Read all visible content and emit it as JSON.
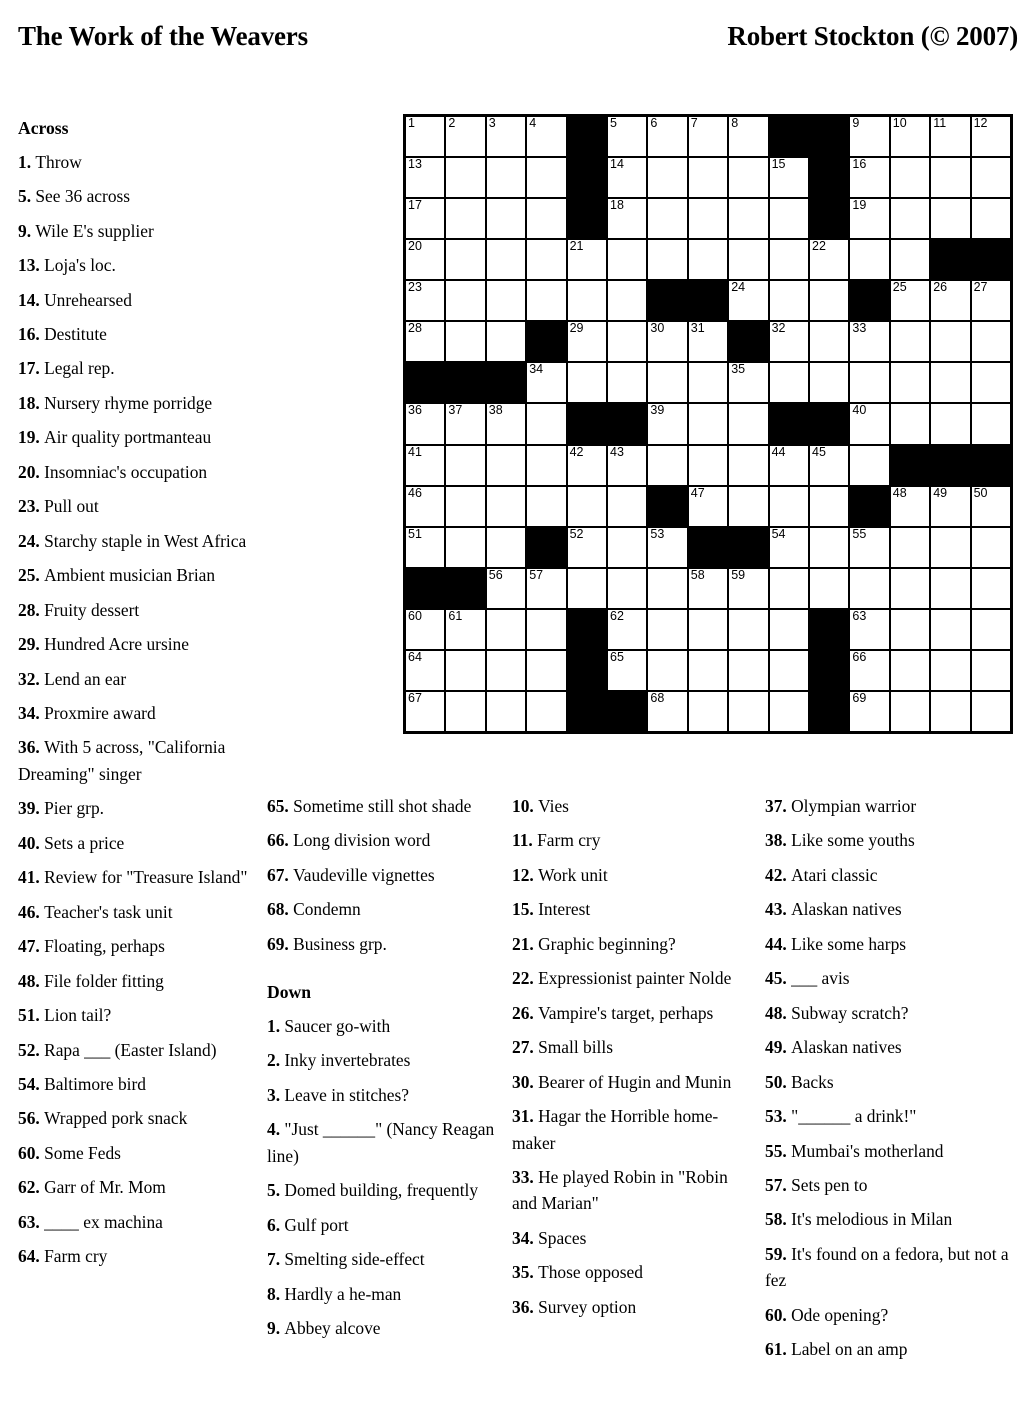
{
  "header": {
    "title": "The Work of the Weavers",
    "author": "Robert Stockton (© 2007)"
  },
  "labels": {
    "across": "Across",
    "down": "Down"
  },
  "grid": {
    "rows": 15,
    "cols": 15,
    "colors": {
      "cell": "#ffffff",
      "block": "#000000",
      "border": "#000000"
    },
    "blocks": [
      [
        0,
        4
      ],
      [
        0,
        9
      ],
      [
        0,
        10
      ],
      [
        1,
        4
      ],
      [
        1,
        10
      ],
      [
        2,
        4
      ],
      [
        2,
        10
      ],
      [
        3,
        13
      ],
      [
        3,
        14
      ],
      [
        4,
        6
      ],
      [
        4,
        7
      ],
      [
        4,
        11
      ],
      [
        5,
        3
      ],
      [
        5,
        8
      ],
      [
        6,
        0
      ],
      [
        6,
        1
      ],
      [
        6,
        2
      ],
      [
        7,
        4
      ],
      [
        7,
        5
      ],
      [
        7,
        9
      ],
      [
        7,
        10
      ],
      [
        8,
        12
      ],
      [
        8,
        13
      ],
      [
        8,
        14
      ],
      [
        9,
        6
      ],
      [
        9,
        11
      ],
      [
        10,
        3
      ],
      [
        10,
        7
      ],
      [
        10,
        8
      ],
      [
        11,
        0
      ],
      [
        11,
        1
      ],
      [
        12,
        4
      ],
      [
        12,
        10
      ],
      [
        13,
        4
      ],
      [
        13,
        10
      ],
      [
        14,
        4
      ],
      [
        14,
        5
      ],
      [
        14,
        10
      ]
    ],
    "numbers": [
      [
        0,
        0,
        "1"
      ],
      [
        0,
        1,
        "2"
      ],
      [
        0,
        2,
        "3"
      ],
      [
        0,
        3,
        "4"
      ],
      [
        0,
        5,
        "5"
      ],
      [
        0,
        6,
        "6"
      ],
      [
        0,
        7,
        "7"
      ],
      [
        0,
        8,
        "8"
      ],
      [
        0,
        11,
        "9"
      ],
      [
        0,
        12,
        "10"
      ],
      [
        0,
        13,
        "11"
      ],
      [
        0,
        14,
        "12"
      ],
      [
        1,
        0,
        "13"
      ],
      [
        1,
        5,
        "14"
      ],
      [
        1,
        9,
        "15"
      ],
      [
        1,
        11,
        "16"
      ],
      [
        2,
        0,
        "17"
      ],
      [
        2,
        5,
        "18"
      ],
      [
        2,
        11,
        "19"
      ],
      [
        3,
        0,
        "20"
      ],
      [
        3,
        4,
        "21"
      ],
      [
        3,
        10,
        "22"
      ],
      [
        4,
        0,
        "23"
      ],
      [
        4,
        8,
        "24"
      ],
      [
        4,
        12,
        "25"
      ],
      [
        4,
        13,
        "26"
      ],
      [
        4,
        14,
        "27"
      ],
      [
        5,
        0,
        "28"
      ],
      [
        5,
        4,
        "29"
      ],
      [
        5,
        6,
        "30"
      ],
      [
        5,
        7,
        "31"
      ],
      [
        5,
        9,
        "32"
      ],
      [
        5,
        11,
        "33"
      ],
      [
        6,
        3,
        "34"
      ],
      [
        6,
        8,
        "35"
      ],
      [
        7,
        0,
        "36"
      ],
      [
        7,
        1,
        "37"
      ],
      [
        7,
        2,
        "38"
      ],
      [
        7,
        6,
        "39"
      ],
      [
        7,
        11,
        "40"
      ],
      [
        8,
        0,
        "41"
      ],
      [
        8,
        4,
        "42"
      ],
      [
        8,
        5,
        "43"
      ],
      [
        8,
        9,
        "44"
      ],
      [
        8,
        10,
        "45"
      ],
      [
        9,
        0,
        "46"
      ],
      [
        9,
        7,
        "47"
      ],
      [
        9,
        12,
        "48"
      ],
      [
        9,
        13,
        "49"
      ],
      [
        9,
        14,
        "50"
      ],
      [
        10,
        0,
        "51"
      ],
      [
        10,
        4,
        "52"
      ],
      [
        10,
        6,
        "53"
      ],
      [
        10,
        9,
        "54"
      ],
      [
        10,
        11,
        "55"
      ],
      [
        11,
        2,
        "56"
      ],
      [
        11,
        3,
        "57"
      ],
      [
        11,
        7,
        "58"
      ],
      [
        11,
        8,
        "59"
      ],
      [
        12,
        0,
        "60"
      ],
      [
        12,
        1,
        "61"
      ],
      [
        12,
        5,
        "62"
      ],
      [
        12,
        11,
        "63"
      ],
      [
        13,
        0,
        "64"
      ],
      [
        13,
        5,
        "65"
      ],
      [
        13,
        11,
        "66"
      ],
      [
        14,
        0,
        "67"
      ],
      [
        14,
        6,
        "68"
      ],
      [
        14,
        11,
        "69"
      ]
    ]
  },
  "across_clues_col1": [
    {
      "num": "1.",
      "text": "Throw"
    },
    {
      "num": "5.",
      "text": "See 36 across"
    },
    {
      "num": "9.",
      "text": "Wile E's supplier"
    },
    {
      "num": "13.",
      "text": "Loja's loc."
    },
    {
      "num": "14.",
      "text": "Unrehearsed"
    },
    {
      "num": "16.",
      "text": "Destitute"
    },
    {
      "num": "17.",
      "text": "Legal rep."
    },
    {
      "num": "18.",
      "text": "Nursery rhyme porridge"
    },
    {
      "num": "19.",
      "text": "Air quality portmanteau"
    },
    {
      "num": "20.",
      "text": "Insomniac's occupation"
    },
    {
      "num": "23.",
      "text": "Pull out"
    },
    {
      "num": "24.",
      "text": "Starchy staple in West Africa"
    },
    {
      "num": "25.",
      "text": "Ambient musician Brian"
    },
    {
      "num": "28.",
      "text": "Fruity dessert"
    },
    {
      "num": "29.",
      "text": "Hundred Acre ursine"
    },
    {
      "num": "32.",
      "text": "Lend an ear"
    },
    {
      "num": "34.",
      "text": "Proxmire award"
    },
    {
      "num": "36.",
      "text": "With 5 across, \"California Dreaming\" singer"
    },
    {
      "num": "39.",
      "text": "Pier grp."
    },
    {
      "num": "40.",
      "text": "Sets a price"
    },
    {
      "num": "41.",
      "text": "Review for \"Treasure Island\""
    },
    {
      "num": "46.",
      "text": "Teacher's task unit"
    },
    {
      "num": "47.",
      "text": "Floating, perhaps"
    },
    {
      "num": "48.",
      "text": "File folder fitting"
    },
    {
      "num": "51.",
      "text": "Lion tail?"
    },
    {
      "num": "52.",
      "text": "Rapa ___ (Easter Island)"
    },
    {
      "num": "54.",
      "text": "Baltimore bird"
    },
    {
      "num": "56.",
      "text": "Wrapped pork snack"
    },
    {
      "num": "60.",
      "text": "Some Feds"
    },
    {
      "num": "62.",
      "text": "Garr of Mr. Mom"
    },
    {
      "num": "63.",
      "text": "____ ex machina"
    },
    {
      "num": "64.",
      "text": "Farm cry"
    }
  ],
  "across_clues_col2": [
    {
      "num": "65.",
      "text": "Sometime still shot shade"
    },
    {
      "num": "66.",
      "text": "Long division word"
    },
    {
      "num": "67.",
      "text": "Vaudeville vignettes"
    },
    {
      "num": "68.",
      "text": "Condemn"
    },
    {
      "num": "69.",
      "text": "Business grp."
    }
  ],
  "down_clues_col2": [
    {
      "num": "1.",
      "text": "Saucer go-with"
    },
    {
      "num": "2.",
      "text": "Inky invertebrates"
    },
    {
      "num": "3.",
      "text": "Leave in stitches?"
    },
    {
      "num": "4.",
      "text": "\"Just ______\" (Nancy Reagan line)"
    },
    {
      "num": "5.",
      "text": "Domed building, frequently"
    },
    {
      "num": "6.",
      "text": "Gulf port"
    },
    {
      "num": "7.",
      "text": "Smelting side-effect"
    },
    {
      "num": "8.",
      "text": "Hardly a he-man"
    },
    {
      "num": "9.",
      "text": "Abbey alcove"
    }
  ],
  "down_clues_col3": [
    {
      "num": "10.",
      "text": "Vies"
    },
    {
      "num": "11.",
      "text": "Farm cry"
    },
    {
      "num": "12.",
      "text": "Work unit"
    },
    {
      "num": "15.",
      "text": "Interest"
    },
    {
      "num": "21.",
      "text": "Graphic beginning?"
    },
    {
      "num": "22.",
      "text": "Expressionist painter Nolde"
    },
    {
      "num": "26.",
      "text": "Vampire's target, perhaps"
    },
    {
      "num": "27.",
      "text": "Small bills"
    },
    {
      "num": "30.",
      "text": "Bearer of Hugin and Munin"
    },
    {
      "num": "31.",
      "text": "Hagar the Horrible home-maker"
    },
    {
      "num": "33.",
      "text": "He played Robin in \"Robin and Marian\""
    },
    {
      "num": "34.",
      "text": "Spaces"
    },
    {
      "num": "35.",
      "text": "Those opposed"
    },
    {
      "num": "36.",
      "text": "Survey option"
    }
  ],
  "down_clues_col4": [
    {
      "num": "37.",
      "text": "Olympian warrior"
    },
    {
      "num": "38.",
      "text": "Like some youths"
    },
    {
      "num": "42.",
      "text": "Atari classic"
    },
    {
      "num": "43.",
      "text": "Alaskan natives"
    },
    {
      "num": "44.",
      "text": "Like some harps"
    },
    {
      "num": "45.",
      "text": "___ avis"
    },
    {
      "num": "48.",
      "text": "Subway scratch?"
    },
    {
      "num": "49.",
      "text": "Alaskan natives"
    },
    {
      "num": "50.",
      "text": "Backs"
    },
    {
      "num": "53.",
      "text": "\"______ a drink!\""
    },
    {
      "num": "55.",
      "text": "Mumbai's motherland"
    },
    {
      "num": "57.",
      "text": "Sets pen to"
    },
    {
      "num": "58.",
      "text": "It's melodious in Milan"
    },
    {
      "num": "59.",
      "text": "It's found on a fedora, but not a fez"
    },
    {
      "num": "60.",
      "text": "Ode opening?"
    },
    {
      "num": "61.",
      "text": "Label on an amp"
    }
  ]
}
